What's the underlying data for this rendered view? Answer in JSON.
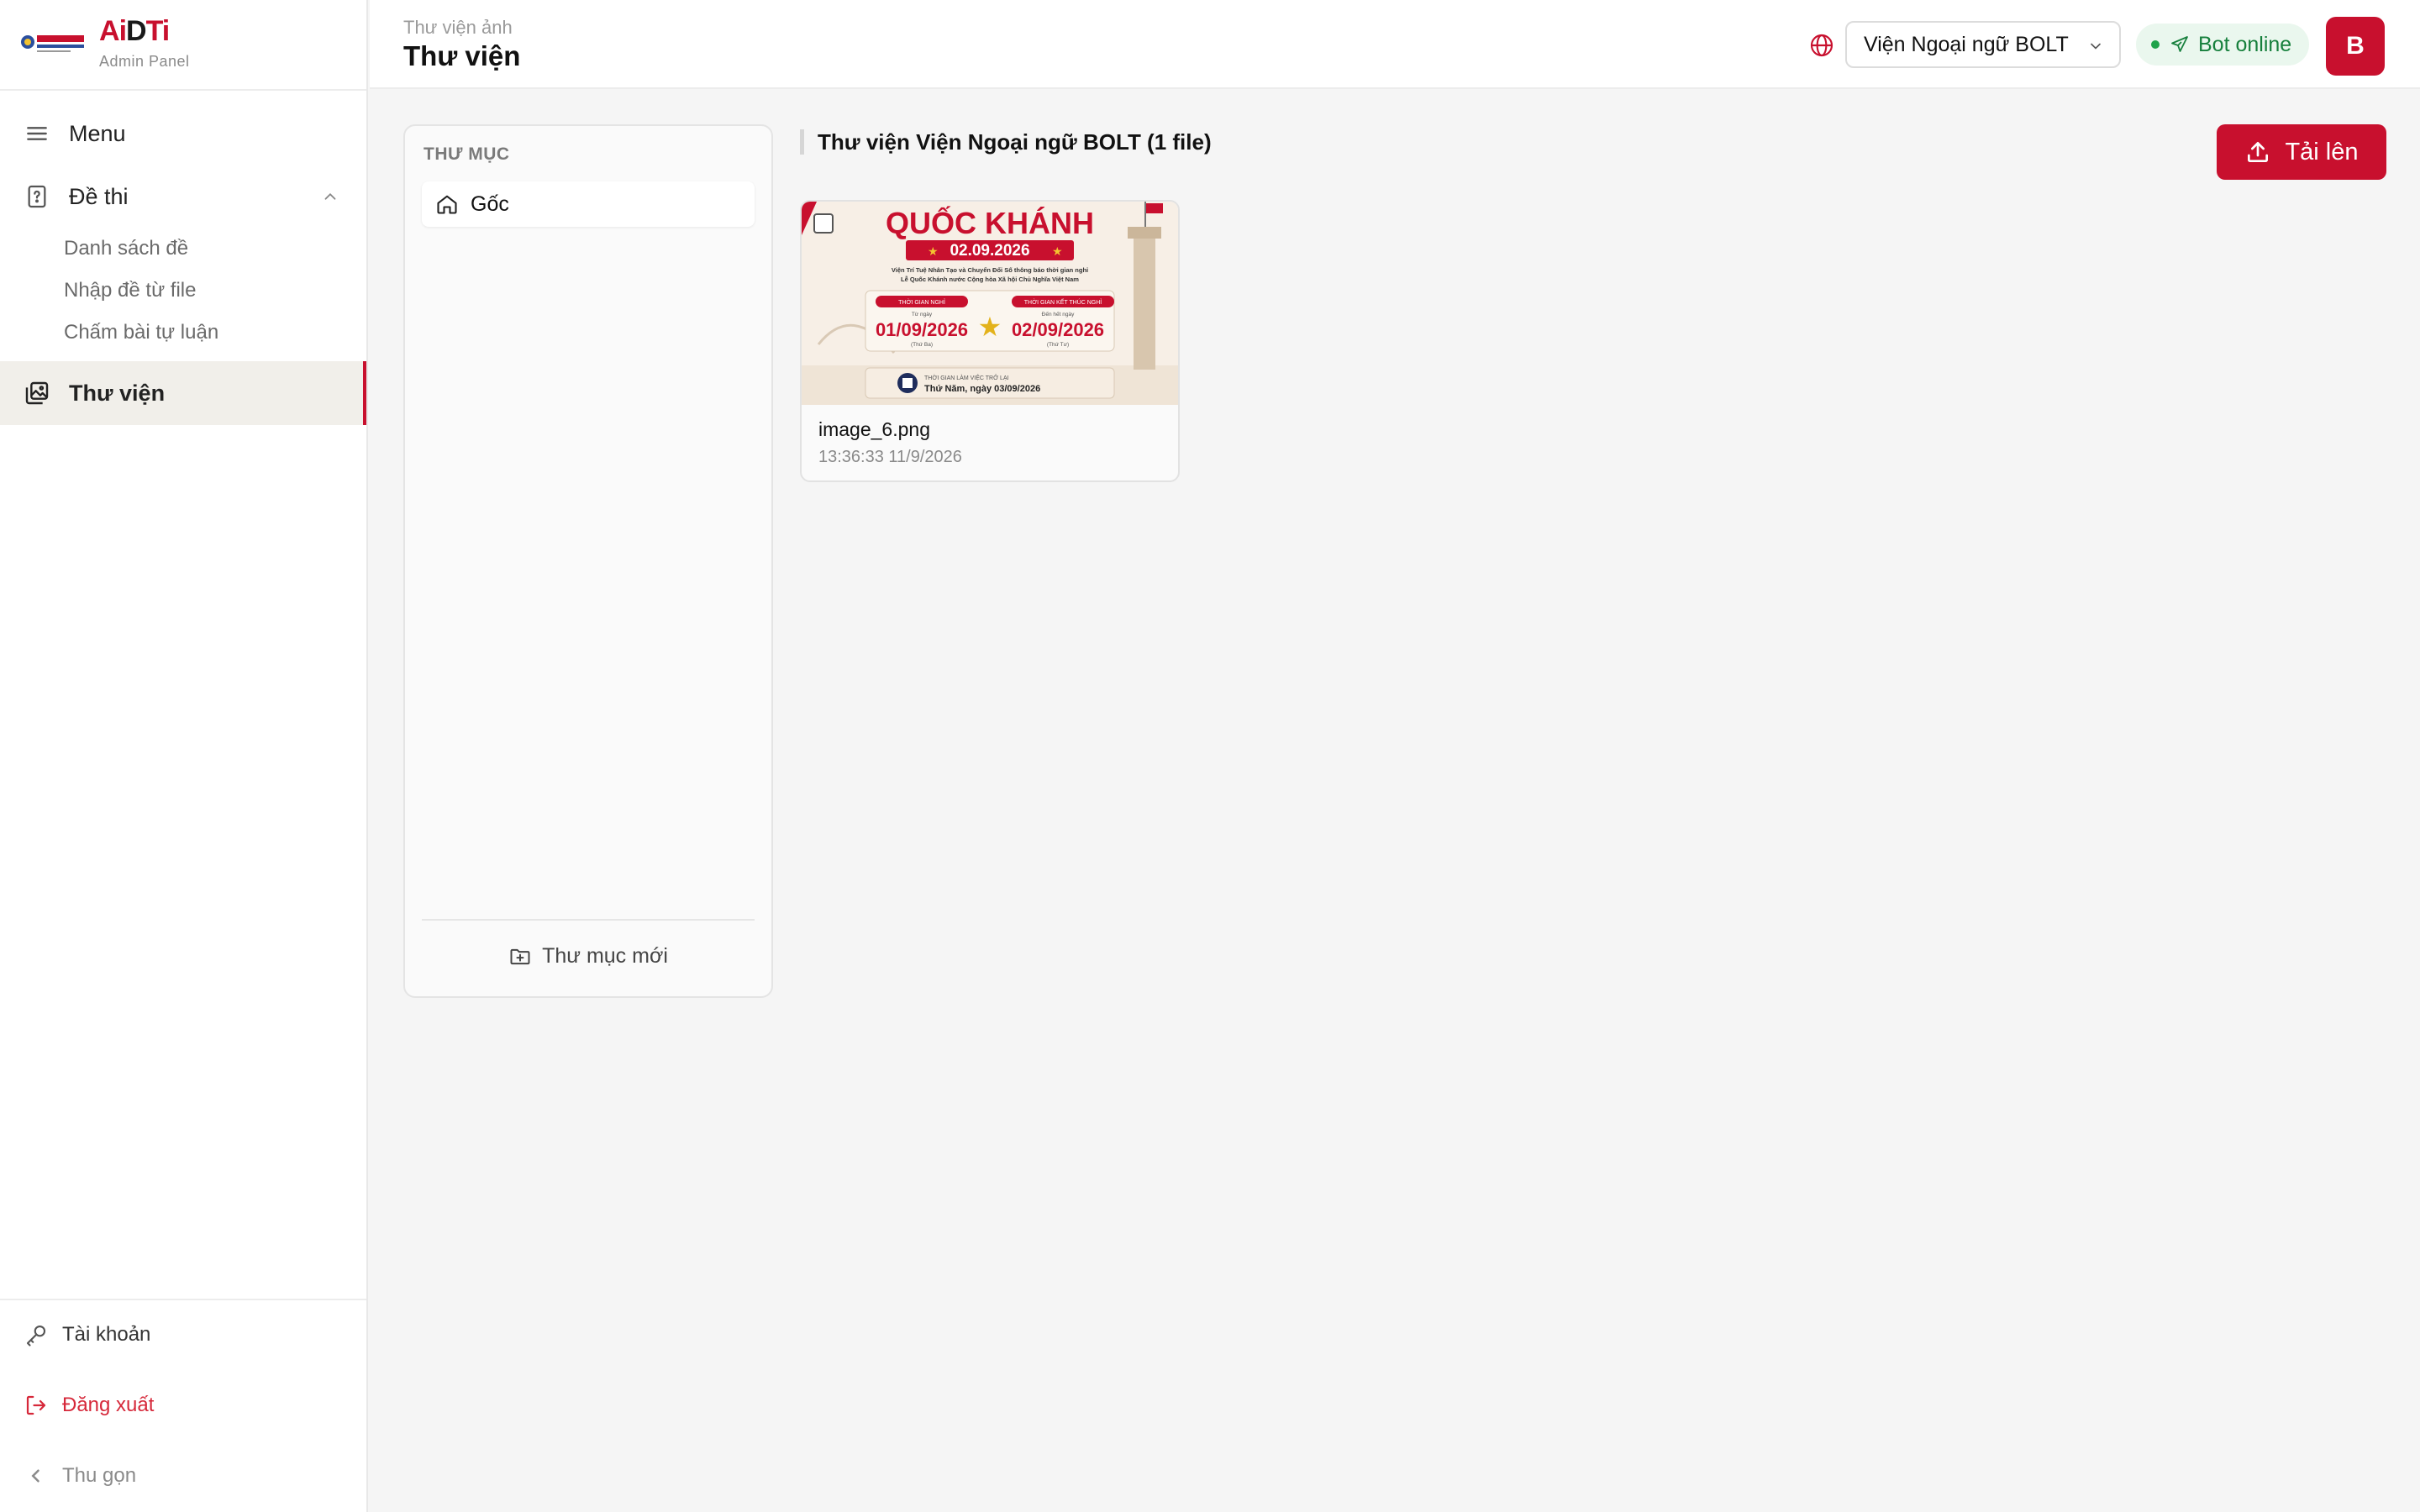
{
  "brand": {
    "logo_text": "AiDTi",
    "subtitle": "Admin Panel",
    "university_logo_text": "BINH DUONG UNIVERSITY"
  },
  "sidebar": {
    "menu_label": "Menu",
    "exam_group": {
      "label": "Đề thi",
      "expanded": true,
      "items": [
        {
          "label": "Danh sách đề"
        },
        {
          "label": "Nhập đề từ file"
        },
        {
          "label": "Chấm bài tự luận"
        }
      ]
    },
    "library_label": "Thư viện",
    "account_label": "Tài khoản",
    "logout_label": "Đăng xuất",
    "collapse_label": "Thu gọn"
  },
  "header": {
    "breadcrumb": "Thư viện ảnh",
    "title": "Thư viện",
    "org_select_value": "Viện Ngoại ngữ BOLT",
    "bot_status": "Bot online",
    "avatar_initial": "B"
  },
  "folders": {
    "title": "THƯ MỤC",
    "root_label": "Gốc",
    "new_folder_label": "Thư mục mới"
  },
  "content": {
    "section_title": "Thư viện Viện Ngoại ngữ BOLT (1 file)",
    "upload_label": "Tải lên",
    "files": [
      {
        "name": "image_6.png",
        "timestamp": "13:36:33 11/9/2026",
        "checked": false,
        "thumbnail": {
          "heading": "QUỐC KHÁNH",
          "date_banner": "02.09.2026",
          "notice_line_1": "Viện Trí Tuệ Nhân Tạo và Chuyển Đổi Số thông báo thời gian nghỉ",
          "notice_line_2": "Lễ Quốc Khánh nước Cộng hòa Xã hội Chủ Nghĩa Việt Nam",
          "start_label": "THỜI GIAN NGHỈ",
          "start_sub": "Từ ngày",
          "start_date": "01/09/2026",
          "start_day": "(Thứ Ba)",
          "end_label": "THỜI GIAN KẾT THÚC NGHỈ",
          "end_sub": "Đến hết ngày",
          "end_date": "02/09/2026",
          "end_day": "(Thứ Tư)",
          "return_label": "THỜI GIAN LÀM VIỆC TRỞ LẠI",
          "return_date": "Thứ Năm, ngày 03/09/2026"
        }
      }
    ]
  },
  "colors": {
    "accent": "#c8102e",
    "online_green": "#17803d",
    "logout_red": "#d6283a"
  }
}
